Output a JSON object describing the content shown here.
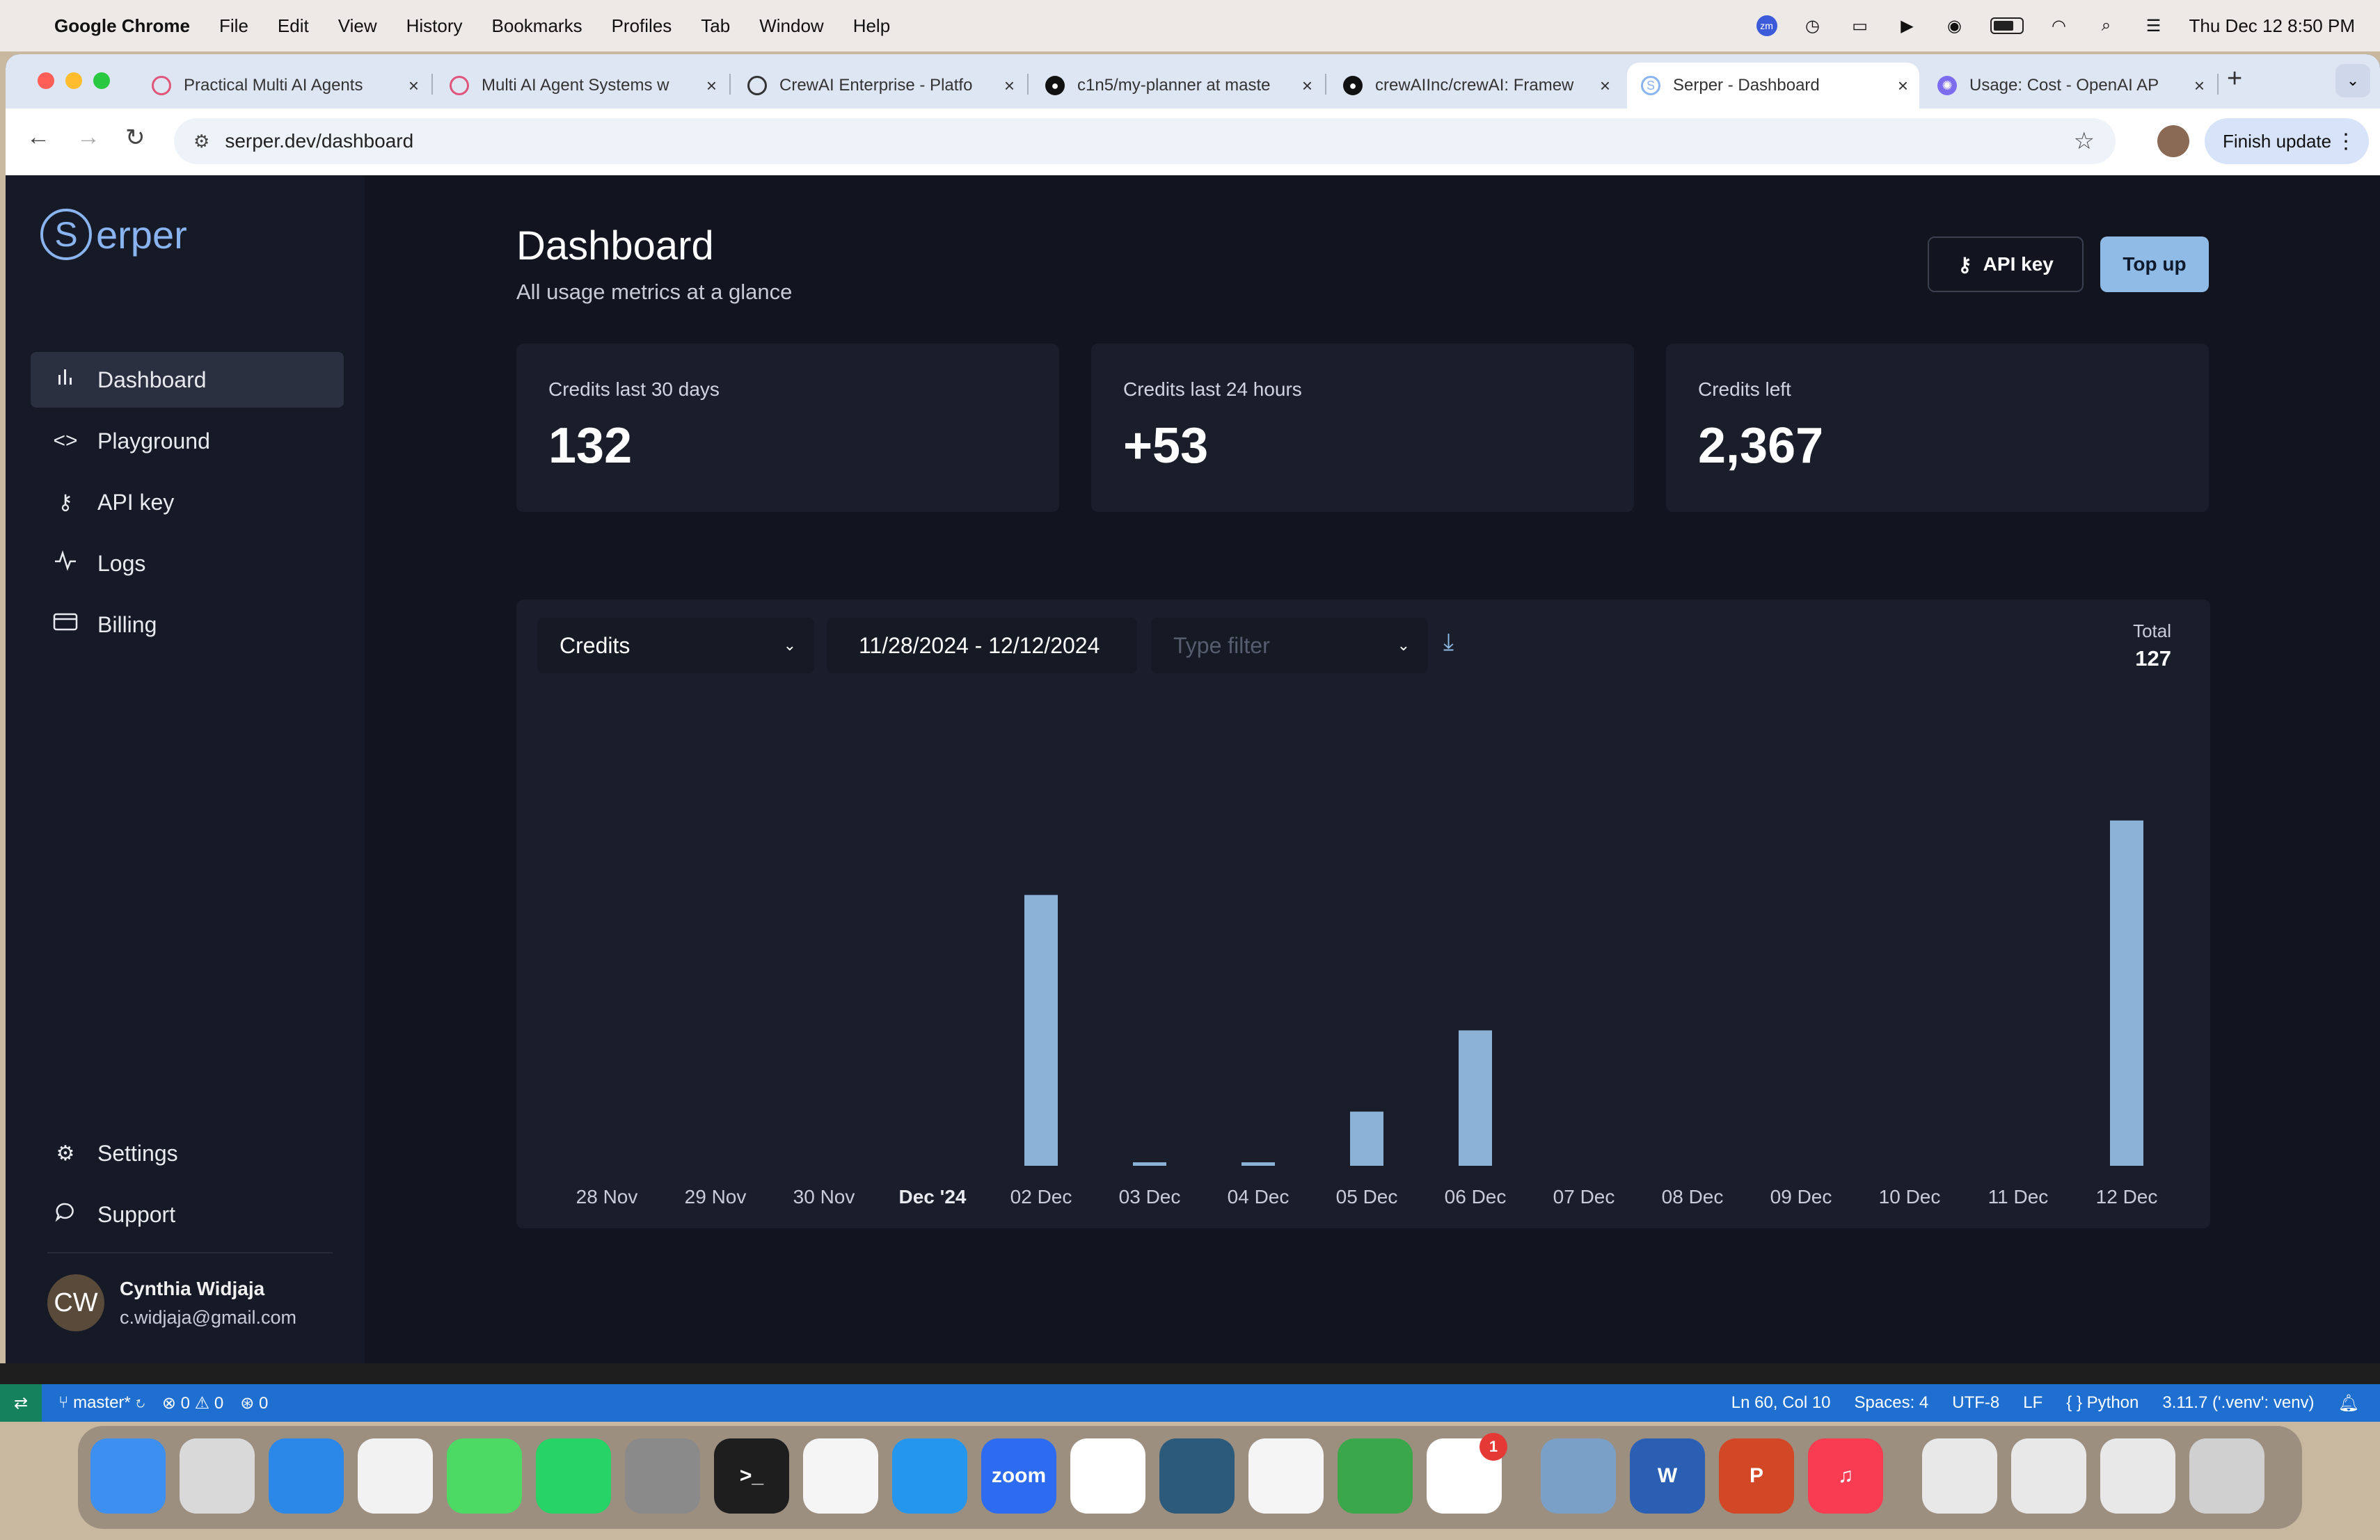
{
  "menubar": {
    "app": "Google Chrome",
    "items": [
      "File",
      "Edit",
      "View",
      "History",
      "Bookmarks",
      "Profiles",
      "Tab",
      "Window",
      "Help"
    ],
    "zoom_badge": "zm",
    "datetime": "Thu Dec 12  8:50 PM"
  },
  "tabs": [
    {
      "title": "Practical Multi AI Agents",
      "favicon": "course-icon",
      "color": "#e0557a"
    },
    {
      "title": "Multi AI Agent Systems w",
      "favicon": "course-icon",
      "color": "#e0557a"
    },
    {
      "title": "CrewAI Enterprise - Platfo",
      "favicon": "crewai-icon",
      "color": "#333333"
    },
    {
      "title": "c1n5/my-planner at maste",
      "favicon": "github-icon",
      "color": "#111111"
    },
    {
      "title": "crewAIInc/crewAI: Framew",
      "favicon": "github-icon",
      "color": "#111111"
    },
    {
      "title": "Serper - Dashboard",
      "favicon": "serper-icon",
      "color": "#8ab4f0",
      "active": true
    },
    {
      "title": "Usage: Cost - OpenAI AP",
      "favicon": "openai-icon",
      "color": "#7b6cf0"
    }
  ],
  "toolbar": {
    "url": "serper.dev/dashboard",
    "finish_update": "Finish update"
  },
  "sidebar": {
    "logo_text": "erper",
    "logo_letter": "S",
    "items": [
      {
        "label": "Dashboard",
        "icon": "bar-chart-icon",
        "active": true
      },
      {
        "label": "Playground",
        "icon": "code-icon"
      },
      {
        "label": "API key",
        "icon": "key-icon"
      },
      {
        "label": "Logs",
        "icon": "activity-icon"
      },
      {
        "label": "Billing",
        "icon": "credit-card-icon"
      }
    ],
    "bottom_items": [
      {
        "label": "Settings",
        "icon": "gear-icon"
      },
      {
        "label": "Support",
        "icon": "chat-bubble-icon"
      }
    ],
    "user": {
      "initials": "CW",
      "name": "Cynthia Widjaja",
      "email": "c.widjaja@gmail.com"
    }
  },
  "main": {
    "title": "Dashboard",
    "subtitle": "All usage metrics at a glance",
    "api_key_button": "API key",
    "top_up_button": "Top up",
    "cards": [
      {
        "label": "Credits last 30 days",
        "value": "132"
      },
      {
        "label": "Credits last 24 hours",
        "value": "+53"
      },
      {
        "label": "Credits left",
        "value": "2,367"
      }
    ],
    "controls": {
      "metric_select": "Credits",
      "date_range": "11/28/2024 - 12/12/2024",
      "type_filter_placeholder": "Type filter"
    },
    "total_label": "Total",
    "total_value": "127"
  },
  "chart_data": {
    "type": "bar",
    "categories": [
      "28 Nov",
      "29 Nov",
      "30 Nov",
      "Dec '24",
      "02 Dec",
      "03 Dec",
      "04 Dec",
      "05 Dec",
      "06 Dec",
      "07 Dec",
      "08 Dec",
      "09 Dec",
      "10 Dec",
      "11 Dec",
      "12 Dec"
    ],
    "values": [
      0,
      0,
      0,
      0,
      40,
      0.5,
      0.5,
      8,
      20,
      0,
      0,
      0,
      0,
      0,
      51
    ],
    "ylim": [
      0,
      60
    ],
    "bold_category": "Dec '24",
    "bar_color": "#8cb2d8",
    "title": "",
    "xlabel": "",
    "ylabel": ""
  },
  "vscode": {
    "branch": "master*",
    "errors": "0",
    "warnings": "0",
    "ports": "0",
    "position": "Ln 60, Col 10",
    "spaces": "Spaces: 4",
    "encoding": "UTF-8",
    "eol": "LF",
    "language": "Python",
    "interpreter": "3.11.7 ('.venv': venv)"
  },
  "dock": {
    "apps": [
      {
        "name": "finder-icon",
        "color": "#3d8ff0",
        "label": ""
      },
      {
        "name": "launchpad-icon",
        "color": "#d9d9d9",
        "label": ""
      },
      {
        "name": "safari-icon",
        "color": "#2b88e8",
        "label": ""
      },
      {
        "name": "chrome-icon",
        "color": "#f2f2f2",
        "label": ""
      },
      {
        "name": "messages-icon",
        "color": "#4cd964",
        "label": ""
      },
      {
        "name": "whatsapp-icon",
        "color": "#25d366",
        "label": ""
      },
      {
        "name": "system-settings-icon",
        "color": "#8a8a8a",
        "label": ""
      },
      {
        "name": "terminal-icon",
        "color": "#1e1e1e",
        "label": ">_"
      },
      {
        "name": "textedit-icon",
        "color": "#f5f5f5",
        "label": ""
      },
      {
        "name": "docker-icon",
        "color": "#2496ed",
        "label": ""
      },
      {
        "name": "zoom-icon",
        "color": "#2d6bf0",
        "label": "zoom"
      },
      {
        "name": "vscode-icon",
        "color": "#ffffff",
        "label": ""
      },
      {
        "name": "mysql-workbench-icon",
        "color": "#2c5a7a",
        "label": ""
      },
      {
        "name": "tableau-icon",
        "color": "#f5f5f5",
        "label": ""
      },
      {
        "name": "progress-icon",
        "color": "#3aa84a",
        "label": ""
      },
      {
        "name": "slack-icon",
        "color": "#ffffff",
        "label": "",
        "badge": "1"
      },
      {
        "name": "preview-icon",
        "color": "#7aa0c8",
        "label": ""
      },
      {
        "name": "word-icon",
        "color": "#2b5fb4",
        "label": "W"
      },
      {
        "name": "powerpoint-icon",
        "color": "#d24726",
        "label": "P"
      },
      {
        "name": "music-icon",
        "color": "#fa3c52",
        "label": "♫"
      },
      {
        "name": "file-icon",
        "color": "#e8e8e8",
        "label": ""
      },
      {
        "name": "screenshot-icon",
        "color": "#e8e8e8",
        "label": ""
      },
      {
        "name": "screenshot-icon-2",
        "color": "#e8e8e8",
        "label": ""
      },
      {
        "name": "trash-icon",
        "color": "#d0d0d0",
        "label": ""
      }
    ]
  }
}
